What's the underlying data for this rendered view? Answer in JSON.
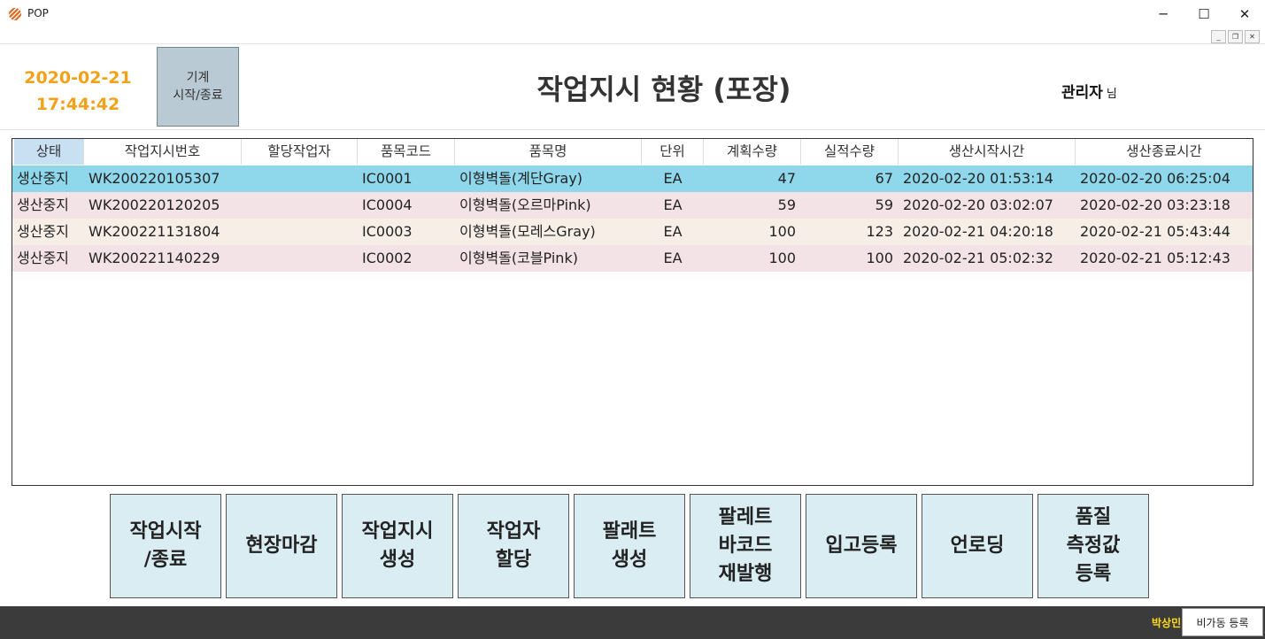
{
  "window": {
    "title": "POP",
    "minimize": "─",
    "maximize": "☐",
    "close": "✕"
  },
  "mdi": {
    "minimize": "_",
    "restore": "❐",
    "close": "✕"
  },
  "header": {
    "date": "2020-02-21",
    "time": "17:44:42",
    "machine_button_line1": "기계",
    "machine_button_line2": "시작/종료",
    "title": "작업지시 현황 (포장)",
    "user_name": "관리자",
    "user_suffix": "님"
  },
  "table": {
    "columns": [
      "상태",
      "작업지시번호",
      "할당작업자",
      "품목코드",
      "품목명",
      "단위",
      "계획수량",
      "실적수량",
      "생산시작시간",
      "생산종료시간"
    ],
    "rows": [
      {
        "status": "생산중지",
        "order_no": "WK200220105307",
        "worker": "",
        "item_code": "IC0001",
        "item_name": "이형벽돌(계단Gray)",
        "unit": "EA",
        "planned": "47",
        "actual": "67",
        "start": "2020-02-20 01:53:14",
        "end": "2020-02-20 06:25:04"
      },
      {
        "status": "생산중지",
        "order_no": "WK200220120205",
        "worker": "",
        "item_code": "IC0004",
        "item_name": "이형벽돌(오르마Pink)",
        "unit": "EA",
        "planned": "59",
        "actual": "59",
        "start": "2020-02-20 03:02:07",
        "end": "2020-02-20 03:23:18"
      },
      {
        "status": "생산중지",
        "order_no": "WK200221131804",
        "worker": "",
        "item_code": "IC0003",
        "item_name": "이형벽돌(모레스Gray)",
        "unit": "EA",
        "planned": "100",
        "actual": "123",
        "start": "2020-02-21 04:20:18",
        "end": "2020-02-21 05:43:44"
      },
      {
        "status": "생산중지",
        "order_no": "WK200221140229",
        "worker": "",
        "item_code": "IC0002",
        "item_name": "이형벽돌(코블Pink)",
        "unit": "EA",
        "planned": "100",
        "actual": "100",
        "start": "2020-02-21 05:02:32",
        "end": "2020-02-21 05:12:43"
      }
    ],
    "row_colors": [
      "#8fd8ec",
      "#f4e3e6",
      "#f7efe7",
      "#f4e3e6"
    ]
  },
  "actions": [
    {
      "label": "작업시작\n/종료"
    },
    {
      "label": "현장마감"
    },
    {
      "label": "작업지시\n생성"
    },
    {
      "label": "작업자\n할당"
    },
    {
      "label": "팔래트\n생성"
    },
    {
      "label": "팔레트\n바코드\n재발행"
    },
    {
      "label": "입고등록"
    },
    {
      "label": "언로딩"
    },
    {
      "label": "품질\n측정값\n등록"
    }
  ],
  "footer": {
    "user_text": "박상민",
    "nonop_button": "비가동 등록"
  },
  "colors": {
    "datetime": "#f2a11a",
    "selected_row": "#8fd8ec",
    "action_button": "#daedf3",
    "footer_bg": "#3b3b3b",
    "footer_user": "#ffd91a"
  }
}
